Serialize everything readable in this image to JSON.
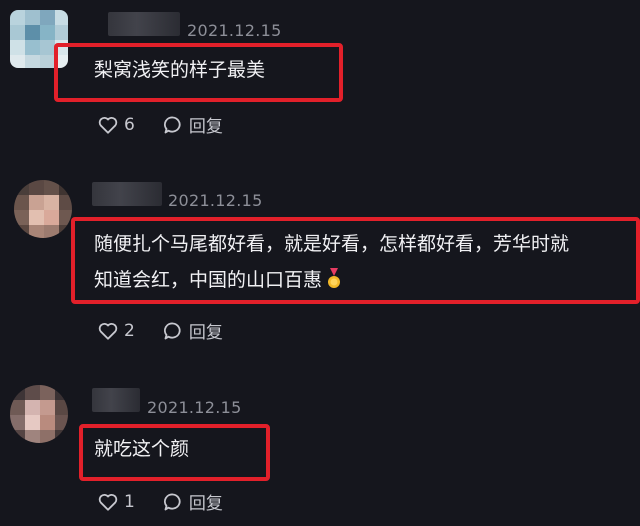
{
  "comments": [
    {
      "date": "2021.12.15",
      "lines": [
        "梨窝浅笑的样子最美"
      ],
      "likes": "6",
      "reply_label": "回复"
    },
    {
      "date": "2021.12.15",
      "lines": [
        "随便扎个马尾都好看，就是好看，怎样都好看，芳华时就",
        "知道会红，中国的山口百惠"
      ],
      "likes": "2",
      "reply_label": "回复"
    },
    {
      "date": "2021.12.15",
      "lines": [
        "就吃这个颜"
      ],
      "likes": "1",
      "reply_label": "回复"
    }
  ],
  "icons": {
    "like": "heart-outline-icon",
    "reply": "speech-bubble-icon",
    "emoji": "medal-emoji"
  },
  "colors": {
    "background": "#15161d",
    "highlight_border": "#e2202a",
    "date_text": "#8d8f98",
    "comment_text": "#f1f1f4"
  }
}
